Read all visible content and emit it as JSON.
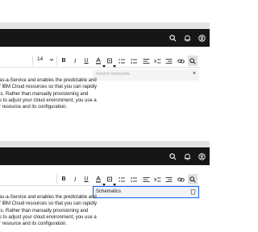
{
  "editor": {
    "font_size": "14",
    "body_lines": [
      "as-a-Service and enables the predictable and",
      "f IBM Cloud resources so that you can rapidly",
      "ts. Rather than manually provisioning and",
      "s to adjust your cloud environment, you use a",
      "r resource and its configuration."
    ]
  },
  "search_top": {
    "placeholder": "Search keywords",
    "clear_glyph": "×"
  },
  "search_bottom": {
    "value": "Schematics"
  },
  "icons": {
    "nav": [
      "search-icon",
      "notification-icon",
      "user-avatar-icon"
    ],
    "toolbar": [
      "bold",
      "italic",
      "underline",
      "text-color",
      "highlight",
      "bullet-list",
      "numbered-list",
      "align",
      "indent",
      "outdent",
      "link",
      "find"
    ]
  },
  "colors": {
    "nav_bg": "#161616",
    "focus": "#0f62fe",
    "field_bg": "#f4f4f4"
  }
}
